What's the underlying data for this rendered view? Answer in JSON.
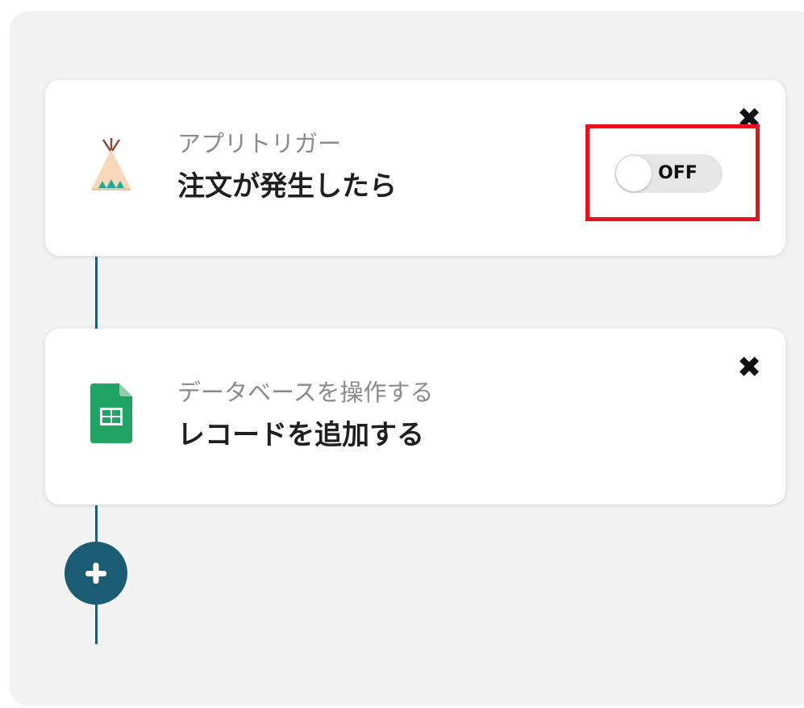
{
  "flow": {
    "trigger": {
      "caption": "アプリトリガー",
      "title": "注文が発生したら",
      "icon": "tipi-tent-icon",
      "toggle_label": "OFF",
      "toggle_state": "off",
      "close_glyph": "✖"
    },
    "action": {
      "caption": "データベースを操作する",
      "title": "レコードを追加する",
      "icon": "google-sheets-icon",
      "close_glyph": "✖"
    },
    "add_step_icon": "plus-icon"
  },
  "colors": {
    "panel_bg": "#f2f2f2",
    "connector": "#1d5f7a",
    "add_button": "#1a5c74",
    "highlight": "#e8101a",
    "sheets_green": "#1fa463"
  }
}
